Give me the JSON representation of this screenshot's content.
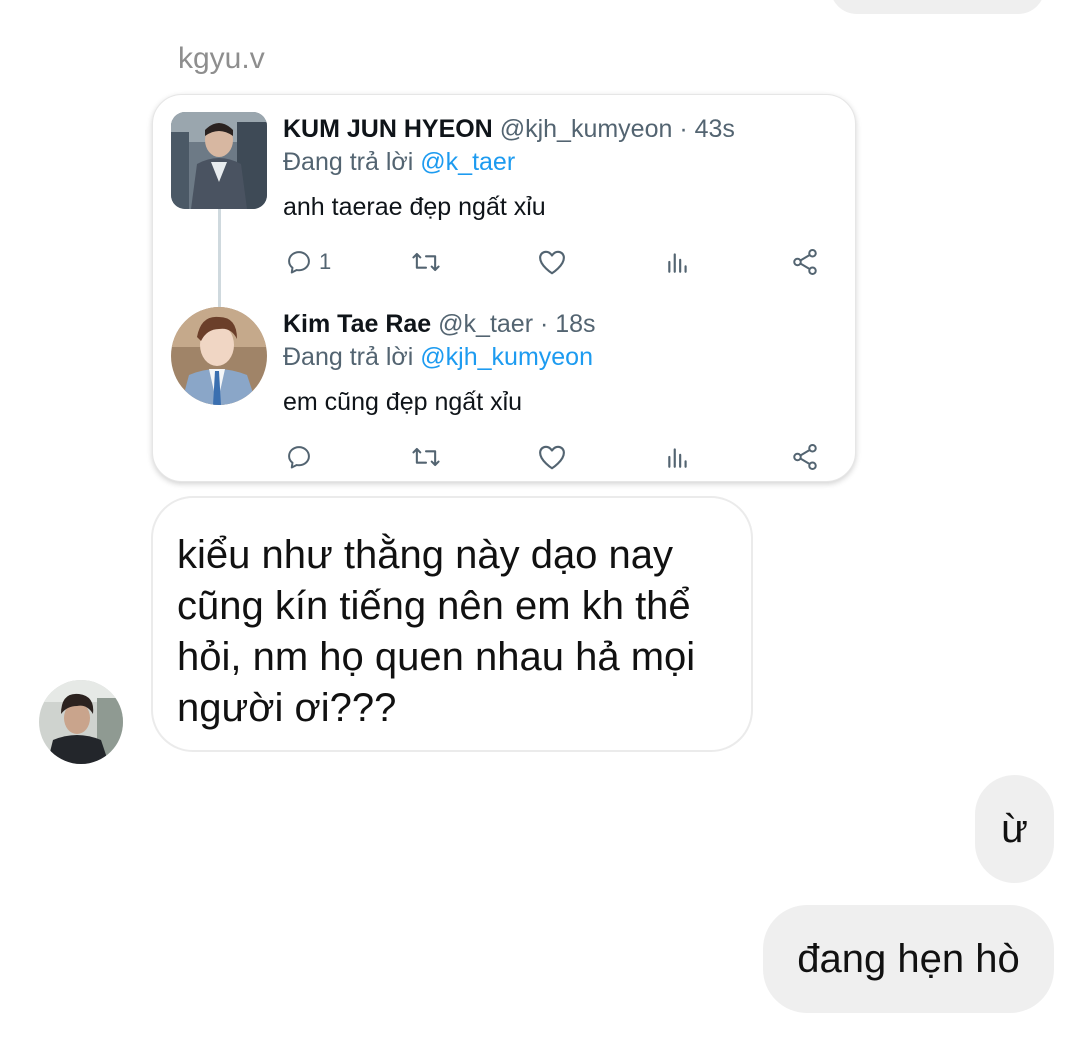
{
  "sender_name": "kgyu.v",
  "tweet_card": {
    "tweets": [
      {
        "display_name": "KUM JUN HYEON",
        "meta": "@kjh_kumyeon · 43s",
        "replying_label": "Đang trả lời",
        "replying_to": "@k_taer",
        "text": "anh taerae đẹp ngất xỉu",
        "reply_count": "1"
      },
      {
        "display_name": "Kim Tae Rae",
        "meta": "@k_taer · 18s",
        "replying_label": "Đang trả lời",
        "replying_to": "@kjh_kumyeon",
        "text": "em cũng đẹp ngất xỉu",
        "reply_count": ""
      }
    ]
  },
  "messages": {
    "received": "kiểu như thằng này dạo nay cũng kín tiếng nên em kh thể hỏi, nm họ quen nhau hả mọi người ơi???",
    "sent": [
      "ừ",
      "đang hẹn hò"
    ]
  },
  "colors": {
    "link": "#1d9bf0",
    "muted": "#536471",
    "sent_bubble": "#efefef"
  },
  "icons": [
    "reply-icon",
    "retweet-icon",
    "like-icon",
    "views-icon",
    "share-icon"
  ]
}
